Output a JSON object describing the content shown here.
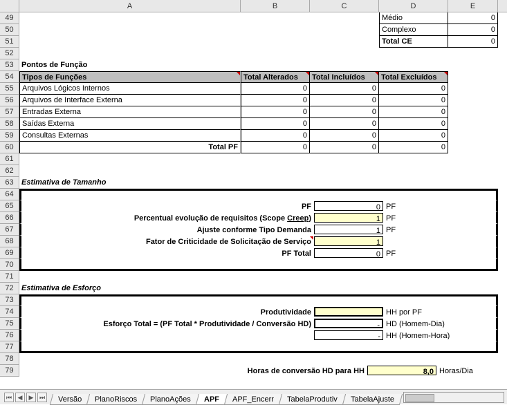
{
  "columns": {
    "A": "A",
    "B": "B",
    "C": "C",
    "D": "D",
    "E": "E"
  },
  "rows_visible": [
    "49",
    "50",
    "51",
    "52",
    "53",
    "54",
    "55",
    "56",
    "57",
    "58",
    "59",
    "60",
    "61",
    "62",
    "63",
    "64",
    "65",
    "66",
    "67",
    "68",
    "69",
    "70",
    "71",
    "72",
    "73",
    "74",
    "75",
    "76",
    "77",
    "78",
    "79"
  ],
  "top_table": {
    "r49": {
      "label": "Médio",
      "val": "0"
    },
    "r50": {
      "label": "Complexo",
      "val": "0"
    },
    "r51": {
      "label": "Total CE",
      "val": "0"
    }
  },
  "section_pf_title": "Pontos de Função",
  "pf_headers": {
    "a": "Tipos de Funções",
    "b": "Total Alterados",
    "c": "Total Incluídos",
    "d": "Total Excluídos"
  },
  "pf_rows": [
    {
      "label": "Arquivos Lógicos Internos",
      "b": "0",
      "c": "0",
      "d": "0"
    },
    {
      "label": "Arquivos de Interface Externa",
      "b": "0",
      "c": "0",
      "d": "0"
    },
    {
      "label": "Entradas Externa",
      "b": "0",
      "c": "0",
      "d": "0"
    },
    {
      "label": "Saídas Externa",
      "b": "0",
      "c": "0",
      "d": "0"
    },
    {
      "label": "Consultas Externas",
      "b": "0",
      "c": "0",
      "d": "0"
    }
  ],
  "pf_total": {
    "label": "Total PF",
    "b": "0",
    "c": "0",
    "d": "0"
  },
  "size_title": "Estimativa de Tamanho",
  "size_rows": {
    "pf": {
      "label": "PF",
      "val": "0",
      "unit": "PF"
    },
    "creep": {
      "label": "Percentual evolução de requisitos (Scope Creep)",
      "link_part": "Creep",
      "val": "1",
      "unit": "PF"
    },
    "ajuste": {
      "label": "Ajuste conforme Tipo Demanda",
      "val": "1",
      "unit": "PF"
    },
    "fator": {
      "label": "Fator de Criticidade de Solicitação de Serviço",
      "val": "1",
      "unit": ""
    },
    "pftotal": {
      "label": "PF Total",
      "val": "0",
      "unit": "PF"
    }
  },
  "effort_title": "Estimativa de Esforço",
  "effort_rows": {
    "prod": {
      "label": "Produtividade",
      "val": "",
      "unit": "HH por PF"
    },
    "etotal": {
      "label": "Esforço Total = (PF Total * Produtividade / Conversão HD)",
      "val": "-",
      "unit": "HD (Homem-Dia)"
    },
    "hh": {
      "val": "-",
      "unit": "HH (Homem-Hora)"
    }
  },
  "conv": {
    "label": "Horas de conversão HD para HH",
    "val": "8,0",
    "unit": "Horas/Dia"
  },
  "tabs": [
    "Versão",
    "PlanoRiscos",
    "PlanoAções",
    "APF",
    "APF_Encerr",
    "TabelaProdutiv",
    "TabelaAjuste"
  ],
  "active_tab": "APF"
}
